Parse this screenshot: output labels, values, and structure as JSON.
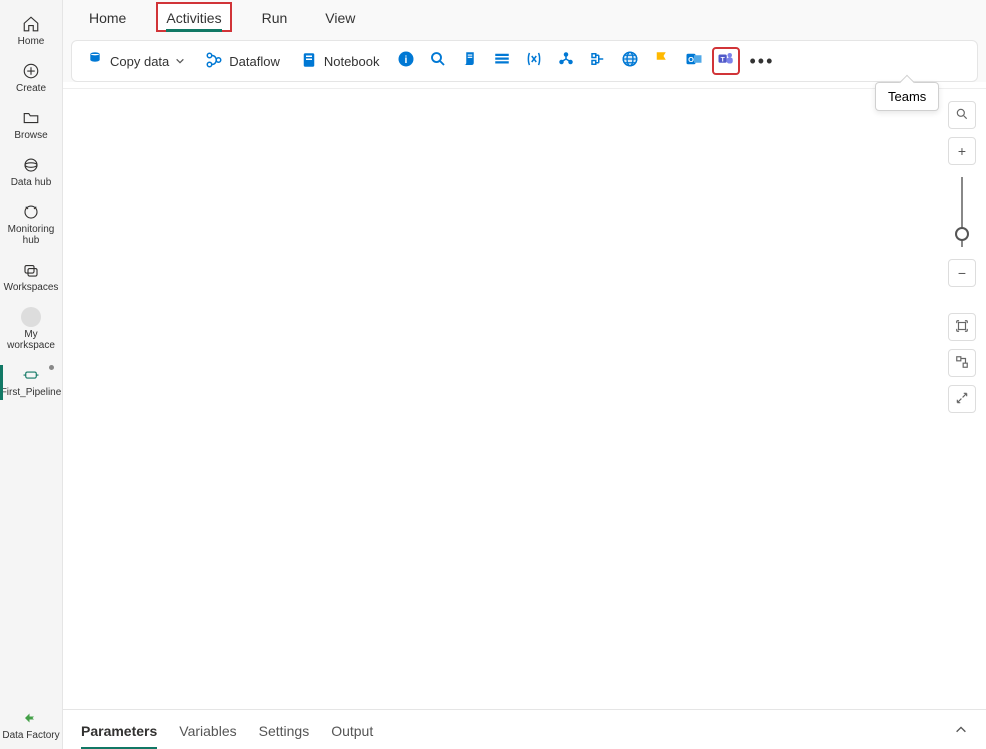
{
  "sidebar": {
    "items": [
      {
        "label": "Home"
      },
      {
        "label": "Create"
      },
      {
        "label": "Browse"
      },
      {
        "label": "Data hub"
      },
      {
        "label": "Monitoring hub"
      },
      {
        "label": "Workspaces"
      },
      {
        "label": "My workspace"
      },
      {
        "label": "First_Pipeline"
      },
      {
        "label": "Data Factory"
      }
    ]
  },
  "top_tabs": {
    "home": "Home",
    "activities": "Activities",
    "run": "Run",
    "view": "View"
  },
  "toolbar": {
    "copy_data": "Copy data",
    "dataflow": "Dataflow",
    "notebook": "Notebook"
  },
  "tooltip": "Teams",
  "bottom_tabs": {
    "parameters": "Parameters",
    "variables": "Variables",
    "settings": "Settings",
    "output": "Output"
  },
  "colors": {
    "brand_green": "#117865",
    "highlight_red": "#d13438",
    "ms_blue": "#0078d4"
  }
}
